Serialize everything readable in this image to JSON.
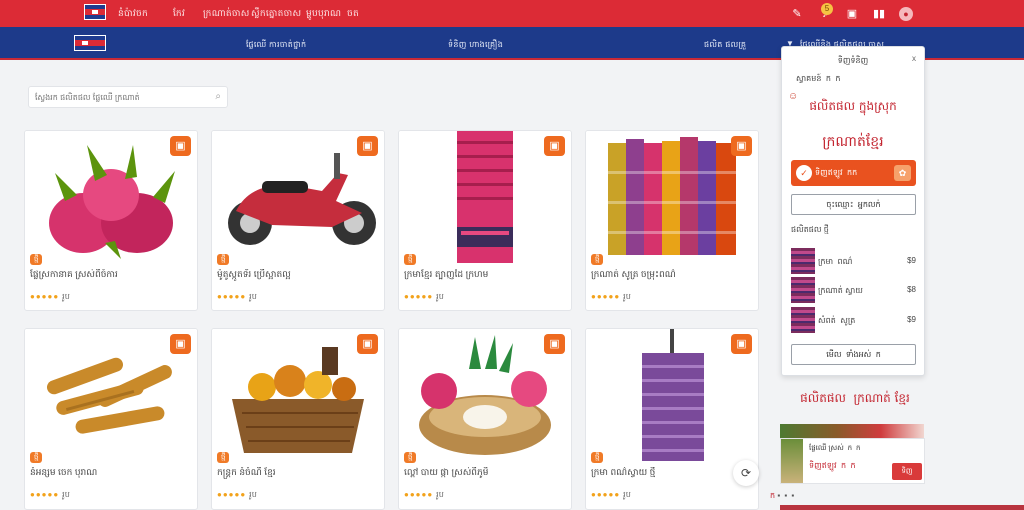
{
  "topbar": {
    "links": [
      "នំ​ប៉ាវ​ចក",
      "កែវ",
      "ក្រណាត់​ចាស",
      "ស្លឹក​ត្នោត​​ចាស",
      "ម្ហូប​បុរាណ ​ ចត"
    ],
    "icons": [
      "tag-icon",
      "bell-icon",
      "cart-icon",
      "menu-icon",
      "user-icon"
    ],
    "bell_badge": "5"
  },
  "navbar": {
    "links": [
      "ផ្លែឈើ ការចាត់ថ្នាក់",
      "ទំនិញ ហាងគ្រឿង",
      "ផលិត ផលគ្រួ"
    ],
    "filter_label": "ផ្លែឈើ​និង​ ផលិតផល ចាស"
  },
  "search": {
    "placeholder": "ស្វែងរក ​ផលិតផល ​ផ្លែឈើ ​ក្រណាត់"
  },
  "products": [
    {
      "title": "ផ្លែស្រកានាគ ស្រស់​ពីចំការ",
      "tag": "ថ្មី",
      "stars": "●●●●●",
      "count": "រូប",
      "img": "dragonfruit",
      "accent": "#d6336c"
    },
    {
      "title": "ម៉ូតូ​ស្កូតទ័រ ​ប្រើ​ស្អាត​ល្អ",
      "tag": "ថ្មី",
      "stars": "●●●●●",
      "count": "រូប",
      "img": "scooter",
      "accent": "#c52d3d"
    },
    {
      "title": "ក្រមា​ខ្មែរ​ ត្បាញ​ដៃ ​ក្រហម",
      "tag": "ថ្មី",
      "stars": "●●●●●",
      "count": "រូប",
      "img": "scarf-red",
      "accent": "#d8326d"
    },
    {
      "title": "ក្រណាត់ ​សូត្រ ​ចម្រុះ​ពណ៌",
      "tag": "ថ្មី",
      "stars": "●●●●●",
      "count": "រូប",
      "img": "fabrics",
      "accent": "#c9a227"
    },
    {
      "title": "នំ​អន្សម​ ចេក ​បុរាណ",
      "tag": "ថ្មី",
      "stars": "●●●●●",
      "count": "រូប",
      "img": "rolls",
      "accent": "#c98a2a"
    },
    {
      "title": "កន្ត្រក​ នំ​ចំណី ​ខ្មែរ",
      "tag": "ថ្មី",
      "stars": "●●●●●",
      "count": "រូប",
      "img": "basket",
      "accent": "#b86a2a"
    },
    {
      "title": "ល្ពៅ​ បាយ​ ផ្កា​ ស្រស់​ពីភូមិ",
      "tag": "ថ្មី",
      "stars": "●●●●●",
      "count": "រូប",
      "img": "bowl",
      "accent": "#d6336c"
    },
    {
      "title": "ក្រមា​ ពណ៌​ស្វាយ ​ថ្មី",
      "tag": "ថ្មី",
      "stars": "●●●●●",
      "count": "រូប",
      "img": "scarf-purple",
      "accent": "#7a4a9a"
    }
  ],
  "panel": {
    "title": "ទិញ​ទំនិញ",
    "close": "x",
    "row": "ស្វាគមន៍ ​ ក ​ ក",
    "mini": "☺",
    "headline": "ផលិតផល​ ក្នុង​ស្រុក",
    "big": "ក្រណាត់​ខ្មែរ",
    "primary_label": "ទិញ​ឥឡូវ ​ កក",
    "secondary_label": "ចុះ​ឈ្មោះ ​ អ្នកលក់",
    "section_label": "ផលិតផល ថ្មី",
    "items": [
      {
        "name": "ក្រមា ​ ពណ៌",
        "price": "$9"
      },
      {
        "name": "ក្រណាត់​ ស្វាយ",
        "price": "$8"
      },
      {
        "name": "សំពត់ ​ សូត្រ",
        "price": "$9"
      }
    ],
    "more_label": "មើល ​ ទាំងអស់ ​ ក"
  },
  "promo": {
    "title": "ផលិតផល ​ ក្រណាត់​ ខ្មែរ",
    "card_text": "ផ្លែឈើ​ ស្រស់ ​ ក ​ ក",
    "card_text2": "ទិញ​ឥឡូវ ​ ក ​ ​ក",
    "card_button": "ទិញ",
    "foot": "ក"
  },
  "colors": {
    "top_red": "#dc2b36",
    "nav_blue": "#1d3a8a",
    "accent_orange": "#e9521f"
  }
}
